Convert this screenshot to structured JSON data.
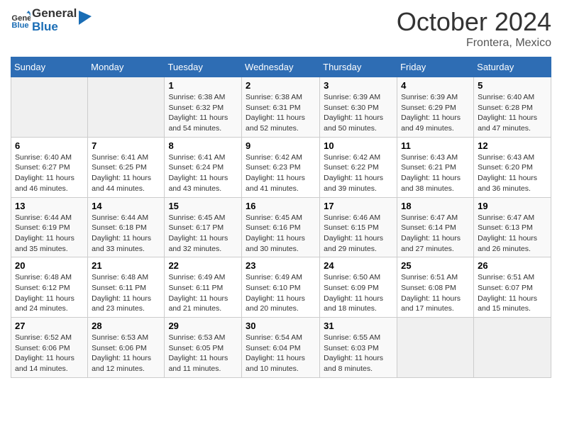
{
  "header": {
    "logo_text_general": "General",
    "logo_text_blue": "Blue",
    "month": "October 2024",
    "location": "Frontera, Mexico"
  },
  "days_of_week": [
    "Sunday",
    "Monday",
    "Tuesday",
    "Wednesday",
    "Thursday",
    "Friday",
    "Saturday"
  ],
  "weeks": [
    [
      {
        "day": "",
        "info": ""
      },
      {
        "day": "",
        "info": ""
      },
      {
        "day": "1",
        "info": "Sunrise: 6:38 AM\nSunset: 6:32 PM\nDaylight: 11 hours and 54 minutes."
      },
      {
        "day": "2",
        "info": "Sunrise: 6:38 AM\nSunset: 6:31 PM\nDaylight: 11 hours and 52 minutes."
      },
      {
        "day": "3",
        "info": "Sunrise: 6:39 AM\nSunset: 6:30 PM\nDaylight: 11 hours and 50 minutes."
      },
      {
        "day": "4",
        "info": "Sunrise: 6:39 AM\nSunset: 6:29 PM\nDaylight: 11 hours and 49 minutes."
      },
      {
        "day": "5",
        "info": "Sunrise: 6:40 AM\nSunset: 6:28 PM\nDaylight: 11 hours and 47 minutes."
      }
    ],
    [
      {
        "day": "6",
        "info": "Sunrise: 6:40 AM\nSunset: 6:27 PM\nDaylight: 11 hours and 46 minutes."
      },
      {
        "day": "7",
        "info": "Sunrise: 6:41 AM\nSunset: 6:25 PM\nDaylight: 11 hours and 44 minutes."
      },
      {
        "day": "8",
        "info": "Sunrise: 6:41 AM\nSunset: 6:24 PM\nDaylight: 11 hours and 43 minutes."
      },
      {
        "day": "9",
        "info": "Sunrise: 6:42 AM\nSunset: 6:23 PM\nDaylight: 11 hours and 41 minutes."
      },
      {
        "day": "10",
        "info": "Sunrise: 6:42 AM\nSunset: 6:22 PM\nDaylight: 11 hours and 39 minutes."
      },
      {
        "day": "11",
        "info": "Sunrise: 6:43 AM\nSunset: 6:21 PM\nDaylight: 11 hours and 38 minutes."
      },
      {
        "day": "12",
        "info": "Sunrise: 6:43 AM\nSunset: 6:20 PM\nDaylight: 11 hours and 36 minutes."
      }
    ],
    [
      {
        "day": "13",
        "info": "Sunrise: 6:44 AM\nSunset: 6:19 PM\nDaylight: 11 hours and 35 minutes."
      },
      {
        "day": "14",
        "info": "Sunrise: 6:44 AM\nSunset: 6:18 PM\nDaylight: 11 hours and 33 minutes."
      },
      {
        "day": "15",
        "info": "Sunrise: 6:45 AM\nSunset: 6:17 PM\nDaylight: 11 hours and 32 minutes."
      },
      {
        "day": "16",
        "info": "Sunrise: 6:45 AM\nSunset: 6:16 PM\nDaylight: 11 hours and 30 minutes."
      },
      {
        "day": "17",
        "info": "Sunrise: 6:46 AM\nSunset: 6:15 PM\nDaylight: 11 hours and 29 minutes."
      },
      {
        "day": "18",
        "info": "Sunrise: 6:47 AM\nSunset: 6:14 PM\nDaylight: 11 hours and 27 minutes."
      },
      {
        "day": "19",
        "info": "Sunrise: 6:47 AM\nSunset: 6:13 PM\nDaylight: 11 hours and 26 minutes."
      }
    ],
    [
      {
        "day": "20",
        "info": "Sunrise: 6:48 AM\nSunset: 6:12 PM\nDaylight: 11 hours and 24 minutes."
      },
      {
        "day": "21",
        "info": "Sunrise: 6:48 AM\nSunset: 6:11 PM\nDaylight: 11 hours and 23 minutes."
      },
      {
        "day": "22",
        "info": "Sunrise: 6:49 AM\nSunset: 6:11 PM\nDaylight: 11 hours and 21 minutes."
      },
      {
        "day": "23",
        "info": "Sunrise: 6:49 AM\nSunset: 6:10 PM\nDaylight: 11 hours and 20 minutes."
      },
      {
        "day": "24",
        "info": "Sunrise: 6:50 AM\nSunset: 6:09 PM\nDaylight: 11 hours and 18 minutes."
      },
      {
        "day": "25",
        "info": "Sunrise: 6:51 AM\nSunset: 6:08 PM\nDaylight: 11 hours and 17 minutes."
      },
      {
        "day": "26",
        "info": "Sunrise: 6:51 AM\nSunset: 6:07 PM\nDaylight: 11 hours and 15 minutes."
      }
    ],
    [
      {
        "day": "27",
        "info": "Sunrise: 6:52 AM\nSunset: 6:06 PM\nDaylight: 11 hours and 14 minutes."
      },
      {
        "day": "28",
        "info": "Sunrise: 6:53 AM\nSunset: 6:06 PM\nDaylight: 11 hours and 12 minutes."
      },
      {
        "day": "29",
        "info": "Sunrise: 6:53 AM\nSunset: 6:05 PM\nDaylight: 11 hours and 11 minutes."
      },
      {
        "day": "30",
        "info": "Sunrise: 6:54 AM\nSunset: 6:04 PM\nDaylight: 11 hours and 10 minutes."
      },
      {
        "day": "31",
        "info": "Sunrise: 6:55 AM\nSunset: 6:03 PM\nDaylight: 11 hours and 8 minutes."
      },
      {
        "day": "",
        "info": ""
      },
      {
        "day": "",
        "info": ""
      }
    ]
  ]
}
